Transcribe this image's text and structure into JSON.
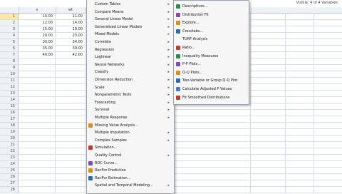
{
  "toolbar": {
    "visible_vars": "Visible: 4 of 4 Variables"
  },
  "columns": [
    "x",
    "wt"
  ],
  "rows": [
    {
      "n": "1",
      "x": "10.00",
      "wt": "11.00"
    },
    {
      "n": "2",
      "x": "12.00",
      "wt": "14.00"
    },
    {
      "n": "3",
      "x": "15.00",
      "wt": "19.00"
    },
    {
      "n": "4",
      "x": "20.00",
      "wt": "23.00"
    },
    {
      "n": "5",
      "x": "30.00",
      "wt": "34.00"
    },
    {
      "n": "6",
      "x": "35.00",
      "wt": "39.00"
    },
    {
      "n": "7",
      "x": "40.00",
      "wt": "42.00"
    },
    {
      "n": "8",
      "x": "",
      "wt": ""
    },
    {
      "n": "9",
      "x": "",
      "wt": ""
    },
    {
      "n": "10",
      "x": "",
      "wt": ""
    },
    {
      "n": "11",
      "x": "",
      "wt": ""
    },
    {
      "n": "12",
      "x": "",
      "wt": ""
    },
    {
      "n": "13",
      "x": "",
      "wt": ""
    },
    {
      "n": "14",
      "x": "",
      "wt": ""
    },
    {
      "n": "15",
      "x": "",
      "wt": ""
    },
    {
      "n": "16",
      "x": "",
      "wt": ""
    },
    {
      "n": "17",
      "x": "",
      "wt": ""
    },
    {
      "n": "18",
      "x": "",
      "wt": ""
    },
    {
      "n": "19",
      "x": "",
      "wt": ""
    },
    {
      "n": "20",
      "x": "",
      "wt": ""
    },
    {
      "n": "21",
      "x": "",
      "wt": ""
    },
    {
      "n": "22",
      "x": "",
      "wt": ""
    },
    {
      "n": "23",
      "x": "",
      "wt": ""
    },
    {
      "n": "24",
      "x": "",
      "wt": ""
    },
    {
      "n": "25",
      "x": "",
      "wt": ""
    },
    {
      "n": "26",
      "x": "",
      "wt": ""
    },
    {
      "n": "27",
      "x": "",
      "wt": ""
    },
    {
      "n": "28",
      "x": "",
      "wt": ""
    }
  ],
  "analyze_menu": [
    {
      "label": "Custom Tables",
      "arrow": true
    },
    {
      "label": "Compare Means",
      "arrow": true
    },
    {
      "label": "General Linear Model",
      "arrow": true
    },
    {
      "label": "Generalized Linear Models",
      "arrow": true
    },
    {
      "label": "Mixed Models",
      "arrow": true
    },
    {
      "label": "Correlate",
      "arrow": true
    },
    {
      "label": "Regression",
      "arrow": true
    },
    {
      "label": "Loglinear",
      "arrow": true
    },
    {
      "label": "Neural Networks",
      "arrow": true
    },
    {
      "label": "Classify",
      "arrow": true
    },
    {
      "label": "Dimension Reduction",
      "arrow": true
    },
    {
      "label": "Scale",
      "arrow": true
    },
    {
      "label": "Nonparametric Tests",
      "arrow": true
    },
    {
      "label": "Forecasting",
      "arrow": true
    },
    {
      "label": "Survival",
      "arrow": true
    },
    {
      "label": "Multiple Response",
      "arrow": true
    },
    {
      "label": "Missing Value Analysis...",
      "arrow": false,
      "icon": "missing-value-icon"
    },
    {
      "label": "Multiple Imputation",
      "arrow": true
    },
    {
      "label": "Complex Samples",
      "arrow": true
    },
    {
      "label": "Simulation...",
      "arrow": false,
      "icon": "simulation-icon"
    },
    {
      "label": "Quality Control",
      "arrow": true
    },
    {
      "label": "ROC Curve...",
      "arrow": false,
      "icon": "roc-curve-icon"
    },
    {
      "label": "RanFor Prediction",
      "arrow": false,
      "icon": "ranfor-prediction-icon"
    },
    {
      "label": "RanFor Estimation...",
      "arrow": false,
      "icon": "ranfor-estimation-icon"
    },
    {
      "label": "Spatial and Temporal Modeling...",
      "arrow": true
    }
  ],
  "descriptive_submenu": [
    {
      "label": "Descriptives...",
      "icon": "descriptives-icon"
    },
    {
      "label": "Distribution Fit",
      "icon": "distribution-fit-icon"
    },
    {
      "label": "Explore...",
      "icon": "explore-icon"
    },
    {
      "label": "Crosstabs...",
      "icon": "crosstabs-icon"
    },
    {
      "label": "TURF Analysis",
      "icon": ""
    },
    {
      "label": "Ratio...",
      "icon": "ratio-icon"
    },
    {
      "label": "Inequality Measures",
      "icon": "inequality-icon"
    },
    {
      "label": "P-P Plots...",
      "icon": "pp-plots-icon"
    },
    {
      "label": "Q-Q Plots...",
      "icon": "qq-plots-icon"
    },
    {
      "label": "Two-Variable or Group Q-Q Plot",
      "icon": "two-var-qq-icon"
    },
    {
      "label": "Calculate Adjusted P Values",
      "icon": "adjusted-p-icon"
    },
    {
      "label": "Fit Smoothed Distributions",
      "icon": "smoothed-dist-icon"
    }
  ],
  "colors": {
    "highlight": "#cfe2f7",
    "selected_row": "#fbe7a8",
    "header": "#eef1f6"
  }
}
